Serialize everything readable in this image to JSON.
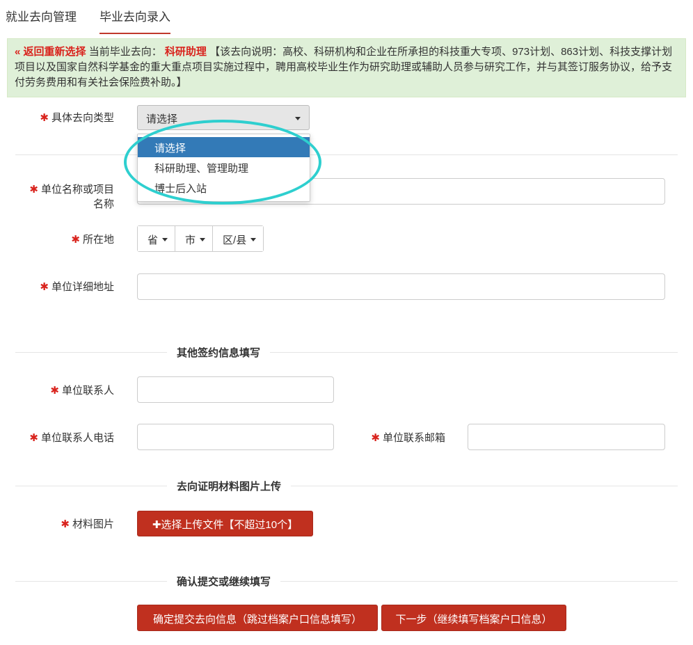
{
  "tabs": [
    {
      "label": "就业去向管理"
    },
    {
      "label": "毕业去向录入"
    }
  ],
  "notice": {
    "back_link": "« 返回重新选择",
    "current_label": "当前毕业去向：",
    "current_value": "科研助理",
    "description": "【该去向说明：高校、科研机构和企业在所承担的科技重大专项、973计划、863计划、科技支撑计划项目以及国家自然科学基金的重大重点项目实施过程中，聘用高校毕业生作为研究助理或辅助人员参与研究工作，并与其签订服务协议，给予支付劳务费用和有关社会保险费补助。】"
  },
  "required_mark": "✱",
  "form": {
    "type_label": "具体去向类型",
    "type_selected": "请选择",
    "type_options": [
      "请选择",
      "科研助理、管理助理",
      "博士后入站"
    ],
    "unit_name_label_l1": "单位名称或项目",
    "unit_name_label_l2": "名称",
    "location_label": "所在地",
    "province": "省",
    "city": "市",
    "district": "区/县",
    "address_label": "单位详细地址"
  },
  "section_other": "其他签约信息填写",
  "contact": {
    "person_label": "单位联系人",
    "phone_label": "单位联系人电话",
    "email_label": "单位联系邮箱"
  },
  "section_upload": "去向证明材料图片上传",
  "upload": {
    "label": "材料图片",
    "button": "✚选择上传文件【不超过10个】"
  },
  "section_confirm": "确认提交或继续填写",
  "actions": {
    "submit": "确定提交去向信息（跳过档案户口信息填写）",
    "next": "下一步（继续填写档案户口信息）"
  },
  "colors": {
    "accent_red": "#c0301f",
    "notice_bg": "#dff0d8",
    "highlight_ring": "#2ecfcf",
    "selected_option": "#337ab7"
  }
}
